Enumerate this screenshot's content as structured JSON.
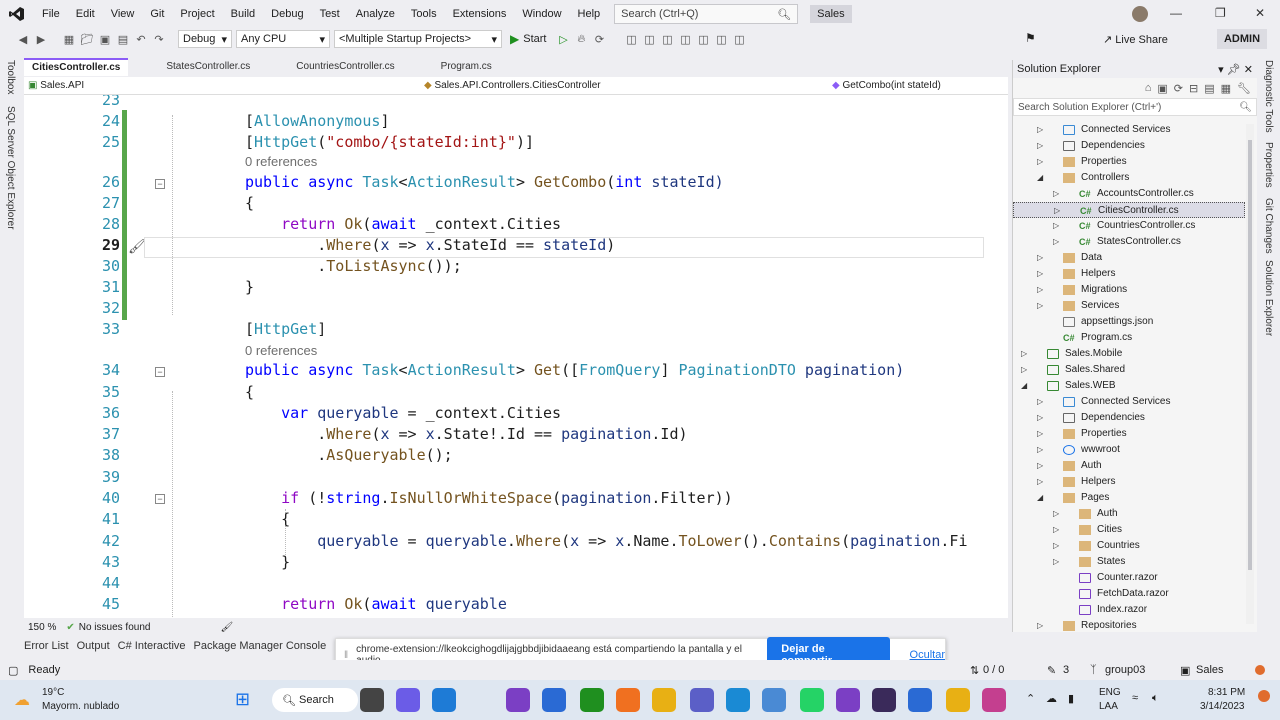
{
  "menu": [
    "File",
    "Edit",
    "View",
    "Git",
    "Project",
    "Build",
    "Debug",
    "Test",
    "Analyze",
    "Tools",
    "Extensions",
    "Window",
    "Help"
  ],
  "search_placeholder": "Search (Ctrl+Q)",
  "solution_name": "Sales",
  "live_share": "Live Share",
  "admin": "ADMIN",
  "toolbar": {
    "config": "Debug",
    "platform": "Any CPU",
    "startup": "<Multiple Startup Projects>",
    "start": "Start"
  },
  "left_rail": {
    "toolbox": "Toolbox",
    "sql": "SQL Server Object Explorer"
  },
  "right_rail": {
    "diag": "Diagnostic Tools",
    "props": "Properties",
    "git": "Git Changes",
    "sol": "Solution Explorer"
  },
  "tabs": [
    "CitiesController.cs",
    "StatesController.cs",
    "CountriesController.cs",
    "Program.cs"
  ],
  "nav": {
    "project": "Sales.API",
    "class": "Sales.API.Controllers.CitiesController",
    "member": "GetCombo(int stateId)"
  },
  "code": {
    "l23": "23",
    "l24": "24",
    "l25": "25",
    "l26": "26",
    "l27": "27",
    "l28": "28",
    "l29": "29",
    "l30": "30",
    "l31": "31",
    "l32": "32",
    "l33": "33",
    "l34": "34",
    "l35": "35",
    "l36": "36",
    "l37": "37",
    "l38": "38",
    "l39": "39",
    "l40": "40",
    "l41": "41",
    "l42": "42",
    "l43": "43",
    "l44": "44",
    "l45": "45",
    "refs1": "0 references",
    "refs2": "0 references",
    "c24a": "[",
    "c24b": "AllowAnonymous",
    "c24c": "]",
    "c25a": "[",
    "c25b": "HttpGet",
    "c25c": "(",
    "c25d": "\"combo/{stateId:int}\"",
    "c25e": ")]",
    "c26a": "public async ",
    "c26b": "Task",
    "c26c": "<",
    "c26d": "ActionResult",
    "c26e": "> ",
    "c26f": "GetCombo",
    "c26g": "(",
    "c26h": "int",
    "c26i": " stateId)",
    "c27": "{",
    "c28a": "    ",
    "c28b": "return ",
    "c28c": "Ok",
    "c28d": "(",
    "c28e": "await",
    "c28f": " _context.Cities",
    "c29a": "        .",
    "c29b": "Where",
    "c29c": "(",
    "c29d": "x",
    "c29e": " => ",
    "c29f": "x",
    "c29g": ".StateId == ",
    "c29h": "stateId",
    "c29i": ")",
    "c30a": "        .",
    "c30b": "ToListAsync",
    "c30c": "());",
    "c31": "}",
    "c33a": "[",
    "c33b": "HttpGet",
    "c33c": "]",
    "c34a": "public async ",
    "c34b": "Task",
    "c34c": "<",
    "c34d": "ActionResult",
    "c34e": "> ",
    "c34f": "Get",
    "c34g": "([",
    "c34h": "FromQuery",
    "c34i": "] ",
    "c34j": "PaginationDTO",
    "c34k": " pagination)",
    "c35": "{",
    "c36a": "    ",
    "c36b": "var",
    "c36c": " queryable",
    "c36d": " = _context.Cities",
    "c37a": "        .",
    "c37b": "Where",
    "c37c": "(",
    "c37d": "x",
    "c37e": " => ",
    "c37f": "x",
    "c37g": ".State!.Id == ",
    "c37h": "pagination",
    "c37i": ".Id)",
    "c38a": "        .",
    "c38b": "AsQueryable",
    "c38c": "();",
    "c40a": "    ",
    "c40b": "if",
    "c40c": " (!",
    "c40d": "string",
    "c40e": ".",
    "c40f": "IsNullOrWhiteSpace",
    "c40g": "(",
    "c40h": "pagination",
    "c40i": ".Filter))",
    "c41": "    {",
    "c42a": "        ",
    "c42b": "queryable",
    "c42c": " = ",
    "c42d": "queryable",
    "c42e": ".",
    "c42f": "Where",
    "c42g": "(",
    "c42h": "x",
    "c42i": " => ",
    "c42j": "x",
    "c42k": ".Name.",
    "c42l": "ToLower",
    "c42m": "().",
    "c42n": "Contains",
    "c42o": "(",
    "c42p": "pagination",
    "c42q": ".Fi",
    "c43": "    }",
    "c45a": "    ",
    "c45b": "return ",
    "c45c": "Ok",
    "c45d": "(",
    "c45e": "await",
    "c45f": " queryable"
  },
  "editor_status": {
    "zoom": "150 %",
    "issues": "No issues found"
  },
  "bottom_tabs": [
    "Error List",
    "Output",
    "C# Interactive",
    "Package Manager Console"
  ],
  "share": {
    "text": "chrome-extension://lkeokcighogdlijajgbbdjibidaaeang está compartiendo la pantalla y el audio.",
    "button": "Dejar de compartir",
    "hide": "Ocultar"
  },
  "status": {
    "ready": "Ready",
    "pos": "0 / 0",
    "pencil": "3",
    "branch": "group03",
    "solution": "Sales"
  },
  "solution_explorer": {
    "title": "Solution Explorer",
    "search": "Search Solution Explorer (Ctrl+')",
    "items": [
      {
        "label": "Connected Services",
        "icon": "connected-services"
      },
      {
        "label": "Dependencies",
        "icon": "dependencies"
      },
      {
        "label": "Properties",
        "icon": "folder"
      },
      {
        "label": "Controllers",
        "icon": "folder"
      },
      {
        "label": "AccountsController.cs",
        "icon": "cs"
      },
      {
        "label": "CitiesController.cs",
        "icon": "cs"
      },
      {
        "label": "CountriesController.cs",
        "icon": "cs"
      },
      {
        "label": "StatesController.cs",
        "icon": "cs"
      },
      {
        "label": "Data",
        "icon": "folder"
      },
      {
        "label": "Helpers",
        "icon": "folder"
      },
      {
        "label": "Migrations",
        "icon": "folder"
      },
      {
        "label": "Services",
        "icon": "folder"
      },
      {
        "label": "appsettings.json",
        "icon": "json"
      },
      {
        "label": "Program.cs",
        "icon": "cs"
      },
      {
        "label": "Sales.Mobile",
        "icon": "project"
      },
      {
        "label": "Sales.Shared",
        "icon": "project"
      },
      {
        "label": "Sales.WEB",
        "icon": "project"
      },
      {
        "label": "Connected Services",
        "icon": "connected-services"
      },
      {
        "label": "Dependencies",
        "icon": "dependencies"
      },
      {
        "label": "Properties",
        "icon": "folder"
      },
      {
        "label": "wwwroot",
        "icon": "globe"
      },
      {
        "label": "Auth",
        "icon": "folder"
      },
      {
        "label": "Helpers",
        "icon": "folder"
      },
      {
        "label": "Pages",
        "icon": "folder"
      },
      {
        "label": "Auth",
        "icon": "folder"
      },
      {
        "label": "Cities",
        "icon": "folder"
      },
      {
        "label": "Countries",
        "icon": "folder"
      },
      {
        "label": "States",
        "icon": "folder"
      },
      {
        "label": "Counter.razor",
        "icon": "razor"
      },
      {
        "label": "FetchData.razor",
        "icon": "razor"
      },
      {
        "label": "Index.razor",
        "icon": "razor"
      },
      {
        "label": "Repositories",
        "icon": "folder"
      }
    ]
  },
  "taskbar": {
    "temp": "19°C",
    "weather": "Mayorm. nublado",
    "search": "Search",
    "lang1": "ENG",
    "lang2": "LAA",
    "time": "8:31 PM",
    "date": "3/14/2023"
  }
}
